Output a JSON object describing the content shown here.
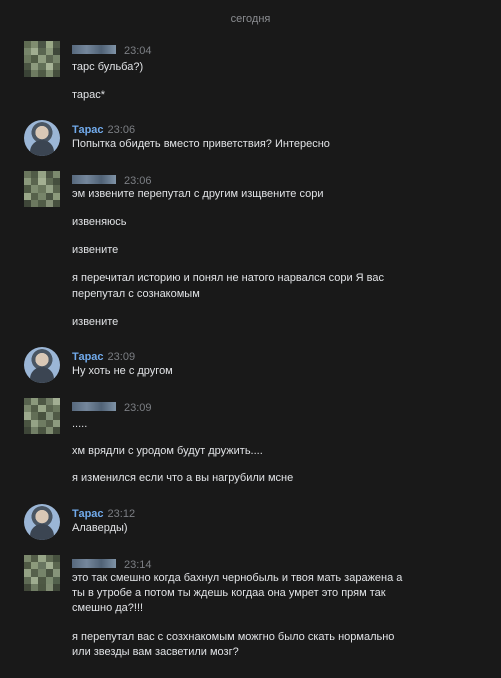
{
  "date_separator": "сегодня",
  "groups": [
    {
      "author": "",
      "time": "23:04",
      "messages": [
        "тарс бульба?)",
        "тарас*"
      ]
    },
    {
      "author": "Тарас",
      "time": "23:06",
      "messages": [
        "Попытка обидеть вместо приветствия? Интересно"
      ]
    },
    {
      "author": "",
      "time": "23:06",
      "messages": [
        "эм извените перепутал с другим изщвените сори",
        "извеняюсь",
        "извените",
        "я перечитал историю и понял не натого нарвался сори Я вас",
        "перепутал с сознакомым",
        "извените"
      ]
    },
    {
      "author": "Тарас",
      "time": "23:09",
      "messages": [
        "Ну хоть не с другом"
      ]
    },
    {
      "author": "",
      "time": "23:09",
      "messages": [
        ".....",
        "хм врядли с уродом будут дружить....",
        "я изменился если что а вы нагрубили мсне"
      ]
    },
    {
      "author": "Тарас",
      "time": "23:12",
      "messages": [
        "Алаверды)"
      ]
    },
    {
      "author": "",
      "time": "23:14",
      "messages": [
        "это так смешно когда бахнул чернобыль и твоя мать заражена а",
        "ты в утробе а потом ты ждешь когдаа она умрет это прям так",
        "смешно да?!!!",
        "я перепутал вас с созхнакомым можгно было скать нормально",
        "или звезды вам засветили мозг?"
      ]
    }
  ],
  "colors": {
    "background": "#191919",
    "name": "#71aaeb",
    "text": "#e1e3e6",
    "meta": "#7c7f84"
  }
}
